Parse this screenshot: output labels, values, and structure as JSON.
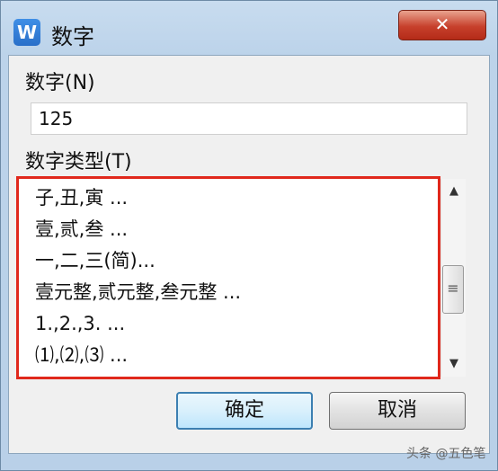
{
  "window": {
    "title": "数字",
    "app_icon_letter": "W",
    "close_glyph": "✕"
  },
  "number_field": {
    "label": "数字(N)",
    "value": "125"
  },
  "type_list": {
    "label": "数字类型(T)",
    "items": [
      "子,丑,寅 ...",
      "壹,贰,叁 ...",
      "一,二,三(简)...",
      "壹元整,贰元整,叁元整 ...",
      " 1.,2.,3. ...",
      "⑴,⑵,⑶ ..."
    ],
    "scroll_up_glyph": "▲",
    "scroll_down_glyph": "▼",
    "scroll_thumb_glyph": "≡"
  },
  "buttons": {
    "ok": "确定",
    "cancel": "取消"
  },
  "watermark": "头条 @五色笔",
  "colors": {
    "highlight_border": "#e0281c",
    "close_button": "#c7402c"
  }
}
